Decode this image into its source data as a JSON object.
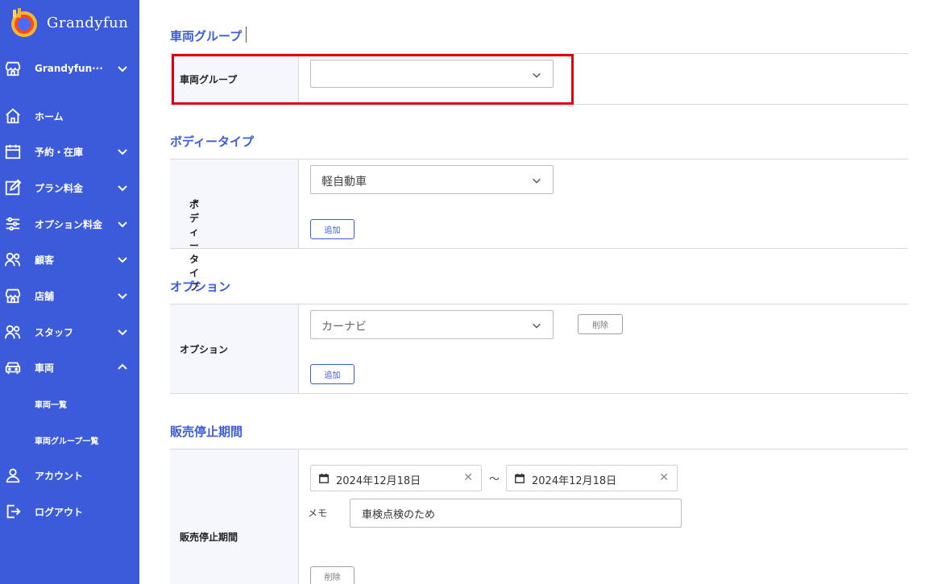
{
  "app": {
    "name": "Grandyfun"
  },
  "sidebar": {
    "store_selector": "Grandyfun···",
    "items": [
      {
        "label": "ホーム",
        "icon": "home-icon"
      },
      {
        "label": "予約・在庫",
        "icon": "calendar-icon"
      },
      {
        "label": "プラン料金",
        "icon": "edit-icon"
      },
      {
        "label": "オプション料金",
        "icon": "sliders-icon"
      },
      {
        "label": "顧客",
        "icon": "users-icon"
      },
      {
        "label": "店舗",
        "icon": "store-icon"
      },
      {
        "label": "スタッフ",
        "icon": "users-icon"
      },
      {
        "label": "車両",
        "icon": "car-icon"
      }
    ],
    "vehicle_subitems": [
      "車両一覧",
      "車両グループ一覧"
    ],
    "account": "アカウント",
    "logout": "ログアウト"
  },
  "form": {
    "vehicle_group": {
      "section_title": "車両グループ",
      "label": "車両グループ",
      "value": ""
    },
    "body_type": {
      "section_title": "ボディータイプ",
      "label": "ボディータイプ",
      "required_mark": "*",
      "value": "軽自動車",
      "add_label": "追加"
    },
    "option": {
      "section_title": "オプション",
      "label": "オプション",
      "value": "カーナビ",
      "delete_label": "削除",
      "add_label": "追加"
    },
    "suspension": {
      "section_title": "販売停止期間",
      "label": "販売停止期間",
      "start_date": "2024年12月18日",
      "end_date": "2024年12月18日",
      "range_separator": "～",
      "memo_label": "メモ",
      "memo_value": "車検点検のため",
      "delete_label": "削除"
    }
  },
  "colors": {
    "sidebar": "#3b5bdb",
    "accent": "#3b5bdb",
    "highlight": "#e0000b",
    "required": "#e03131"
  }
}
